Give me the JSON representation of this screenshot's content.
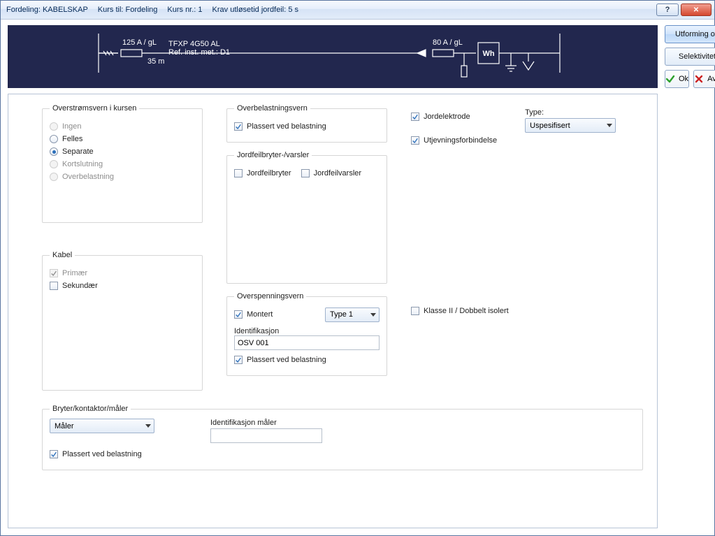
{
  "title": {
    "p1": "Fordeling: KABELSKAP",
    "p2": "Kurs til: Fordeling",
    "p3": "Kurs nr.: 1",
    "p4": "Krav utløsetid jordfeil: 5 s"
  },
  "diagram": {
    "fuse1": "125 A / gL",
    "len": "35 m",
    "cable1": "TFXP 4G50 AL",
    "cable2": "Ref. inst. met.: D1",
    "fuse2": "80 A / gL",
    "wh": "Wh"
  },
  "sidebar_buttons": {
    "design": "Utforming og beskyttelse",
    "select": "Selektivitet",
    "ok": "Ok",
    "cancel": "Avbryt"
  },
  "overstrom": {
    "legend": "Overstrømsvern i kursen",
    "ingen": "Ingen",
    "felles": "Felles",
    "separate": "Separate",
    "kort": "Kortslutning",
    "over": "Overbelastning"
  },
  "kabel": {
    "legend": "Kabel",
    "primar": "Primær",
    "sekundar": "Sekundær"
  },
  "overbel": {
    "legend": "Overbelastningsvern",
    "plassert": "Plassert ved belastning"
  },
  "jordfeil": {
    "legend": "Jordfeilbryter-/varsler",
    "bryter": "Jordfeilbryter",
    "varsler": "Jordfeilvarsler"
  },
  "overspenn": {
    "legend": "Overspenningsvern",
    "montert": "Montert",
    "type1": "Type 1",
    "ident_label": "Identifikasjon",
    "ident_value": "OSV 001",
    "plassert": "Plassert ved belastning"
  },
  "bryter": {
    "legend": "Bryter/kontaktor/måler",
    "maler": "Måler",
    "plassert": "Plassert ved belastning",
    "ident_label": "Identifikasjon måler"
  },
  "right_col": {
    "jordelek": "Jordelektrode",
    "utjevn": "Utjevningsforbindelse",
    "klasse2": "Klasse II / Dobbelt isolert",
    "type_label": "Type:",
    "type_value": "Uspesifisert"
  }
}
